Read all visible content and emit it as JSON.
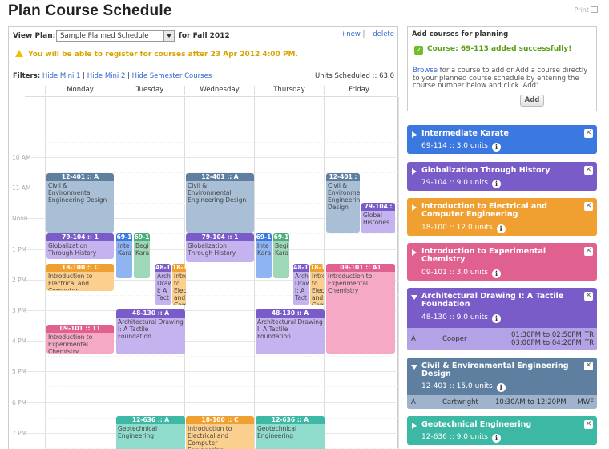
{
  "page_title": "Plan Course Schedule",
  "print_label": "Print",
  "toolbar": {
    "view_plan_label": "View Plan:",
    "plan_selected": "Sample Planned Schedule",
    "term_label": "for Fall 2012",
    "new_label": "+new",
    "delete_label": "−delete"
  },
  "warning_text": "You will be able to register for courses after 23 Apr 2012 4:00 PM.",
  "filters": {
    "label": "Filters:",
    "items": [
      "Hide Mini 1",
      "Hide Mini 2",
      "Hide Semester Courses"
    ],
    "units_scheduled": "Units Scheduled :: 63.0"
  },
  "days": [
    "Monday",
    "Tuesday",
    "Wednesday",
    "Thursday",
    "Friday"
  ],
  "hours": [
    "10 AM",
    "11 AM",
    "Noon",
    "1 PM",
    "2 PM",
    "3 PM",
    "4 PM",
    "5 PM",
    "6 PM",
    "7 PM",
    "8 PM"
  ],
  "events": [
    {
      "hdr": "12-401 :: A",
      "body": "Civil & Environmental Engineering Design",
      "color": "#5f7fa0",
      "bg": "#a9bfd6"
    },
    {
      "hdr": "79-104 :: 1",
      "body": "Globalization Through History",
      "color": "#7a5cc8",
      "bg": "#c5b3ef"
    },
    {
      "hdr": "18-100 :: C",
      "body": "Introduction to Electrical and Computer",
      "color": "#f0a030",
      "bg": "#fbd08e"
    },
    {
      "hdr": "09-101 :: 11",
      "body": "Introduction to Experimental Chemistry",
      "color": "#e06090",
      "bg": "#f5a9c4"
    },
    {
      "hdr": "69-1",
      "body": "Inte Kara",
      "color": "#3b78e0",
      "bg": "#8fb4f2"
    },
    {
      "hdr": "69-1",
      "body": "Begi Kara",
      "color": "#4caf7a",
      "bg": "#9ed8b8"
    },
    {
      "hdr": "48-1",
      "body": "Arch Draw I: A Tact",
      "color": "#7a5cc8",
      "bg": "#c5b3ef"
    },
    {
      "hdr": "18-1",
      "body": "Intro to Elec and Com",
      "color": "#f0a030",
      "bg": "#fbd08e"
    },
    {
      "hdr": "48-130 :: A",
      "body": "Architectural Drawing I: A Tactile Foundation",
      "color": "#7a5cc8",
      "bg": "#c5b3ef"
    },
    {
      "hdr": "12-636 :: A",
      "body": "Geotechnical Engineering",
      "color": "#3cb8a4",
      "bg": "#8fdccd"
    },
    {
      "hdr": "12-401 :: A",
      "body": "Civil & Environmental Engineering Design",
      "color": "#5f7fa0",
      "bg": "#a9bfd6"
    },
    {
      "hdr": "79-104 :: 1",
      "body": "Globalization Through History",
      "color": "#7a5cc8",
      "bg": "#c5b3ef"
    },
    {
      "hdr": "18-100 :: C",
      "body": "Introduction to Electrical and Computer Engineering",
      "color": "#f0a030",
      "bg": "#fbd08e"
    },
    {
      "hdr": "69-1",
      "body": "Inte Kara",
      "color": "#3b78e0",
      "bg": "#8fb4f2"
    },
    {
      "hdr": "69-1",
      "body": "Begi Kara",
      "color": "#4caf7a",
      "bg": "#9ed8b8"
    },
    {
      "hdr": "48-1",
      "body": "Arch Draw I: A Tact",
      "color": "#7a5cc8",
      "bg": "#c5b3ef"
    },
    {
      "hdr": "18-1",
      "body": "Intro to Elec and Com",
      "color": "#f0a030",
      "bg": "#fbd08e"
    },
    {
      "hdr": "48-130 :: A",
      "body": "Architectural Drawing I: A Tactile Foundation",
      "color": "#7a5cc8",
      "bg": "#c5b3ef"
    },
    {
      "hdr": "12-636 :: A",
      "body": "Geotechnical Engineering",
      "color": "#3cb8a4",
      "bg": "#8fdccd"
    },
    {
      "hdr": "12-401 :",
      "body": "Civil & Environmental Engineering Design",
      "color": "#5f7fa0",
      "bg": "#a9bfd6"
    },
    {
      "hdr": "79-104 :",
      "body": "Global Histories",
      "color": "#7a5cc8",
      "bg": "#c5b3ef"
    },
    {
      "hdr": "09-101 :: A1",
      "body": "Introduction to Experimental Chemistry",
      "color": "#e06090",
      "bg": "#f5a9c4"
    }
  ],
  "add_box": {
    "title": "Add courses for planning",
    "success": "Course: 69-113 added successfully!",
    "browse_link": "Browse",
    "browse_text": " for a course to add or Add a course directly to your planned course schedule by entering the course number below and click 'Add'",
    "add_button": "Add"
  },
  "courses": [
    {
      "title": "Intermediate Karate",
      "info": "69-114 :: 3.0 units",
      "color": "#3b78e0"
    },
    {
      "title": "Globalization Through History",
      "info": "79-104 :: 9.0 units",
      "color": "#7a5cc8"
    },
    {
      "title": "Introduction to Electrical and Computer Engineering",
      "info": "18-100 :: 12.0 units",
      "color": "#f0a030"
    },
    {
      "title": "Introduction to Experimental Chemistry",
      "info": "09-101 :: 3.0 units",
      "color": "#e06090"
    },
    {
      "title": "Architectural Drawing I: A Tactile Foundation",
      "info": "48-130 :: 9.0 units",
      "color": "#7a5cc8",
      "section": {
        "sec": "A",
        "instructor": "Cooper",
        "times": "01:30PM to 02:50PM",
        "times2": "03:00PM to 04:20PM",
        "days": "TR",
        "days2": "TR"
      }
    },
    {
      "title": "Civil & Environmental Engineering Design",
      "info": "12-401 :: 15.0 units",
      "color": "#5f7fa0",
      "section": {
        "sec": "A",
        "instructor": "Cartwright",
        "times": "10:30AM to 12:20PM",
        "days": "MWF"
      }
    },
    {
      "title": "Geotechnical Engineering",
      "info": "12-636 :: 9.0 units",
      "color": "#3cb8a4"
    }
  ],
  "info_glyph": "i",
  "close_glyph": "✕",
  "check_glyph": "✓"
}
